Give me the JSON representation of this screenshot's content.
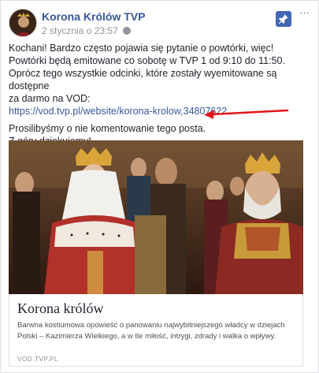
{
  "post": {
    "page_name": "Korona Królów TVP",
    "timestamp": "2 stycznia o 23:57",
    "paragraph1": [
      "Kochani! Bardzo często pojawia się pytanie o powtórki, więc!",
      "Powtórki będą emitowane co sobotę w TVP 1 od 9:10 do 11:50.",
      "Oprócz tego wszystkie odcinki, które zostały wyemitowane są dostępne",
      "za darmo na VOD:"
    ],
    "link_url": "https://vod.tvp.pl/website/korona-krolow,34807622",
    "paragraph2": [
      "Prosilibyśmy o nie komentowanie tego posta.",
      "Z góry dziękujemy!"
    ]
  },
  "icons": {
    "globe": "globe-icon",
    "pin": "pin-icon",
    "more": "more-options-icon",
    "arrow": "red-arrow-icon"
  },
  "colors": {
    "link": "#365899",
    "arrow": "#e0161b",
    "pin_button": "#4267b2"
  },
  "link_preview": {
    "title": "Korona królów",
    "description": "Barwna kostiumowa opowieść o panowaniu najwybitniejszego władcy w dziejach Polski – Kazimierza Wielkiego, a w tle miłość, intrygi, zdrady i walka o wpływy.",
    "domain": "VOD.TVP.PL"
  },
  "header": {
    "more_glyph": "···"
  }
}
